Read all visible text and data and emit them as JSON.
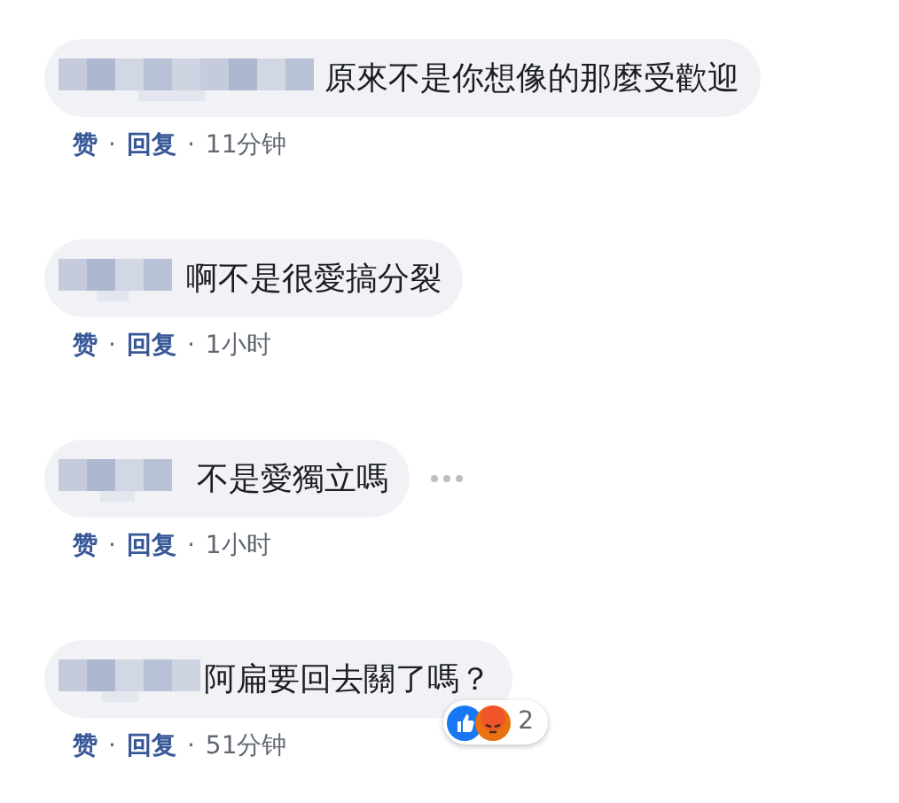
{
  "comments": [
    {
      "text": "原來不是你想像的那麼受歡迎",
      "actions": [
        "赞",
        "回复"
      ],
      "separator": "·",
      "time": "11分钟",
      "more_menu": false
    },
    {
      "text": "啊不是很愛搞分裂",
      "actions": [
        "赞",
        "回复"
      ],
      "separator": "·",
      "time": "1小时",
      "more_menu": false
    },
    {
      "text": "不是愛獨立嗎",
      "actions": [
        "赞",
        "回复"
      ],
      "separator": "·",
      "time": "1小时",
      "more_menu": true
    },
    {
      "text": "阿扁要回去關了嗎？",
      "actions": [
        "赞",
        "回复"
      ],
      "separator": "·",
      "time": "51分钟",
      "more_menu": false,
      "reactions": {
        "icons": [
          {
            "kind": "like"
          },
          {
            "kind": "angry"
          }
        ],
        "count": "2"
      }
    }
  ]
}
